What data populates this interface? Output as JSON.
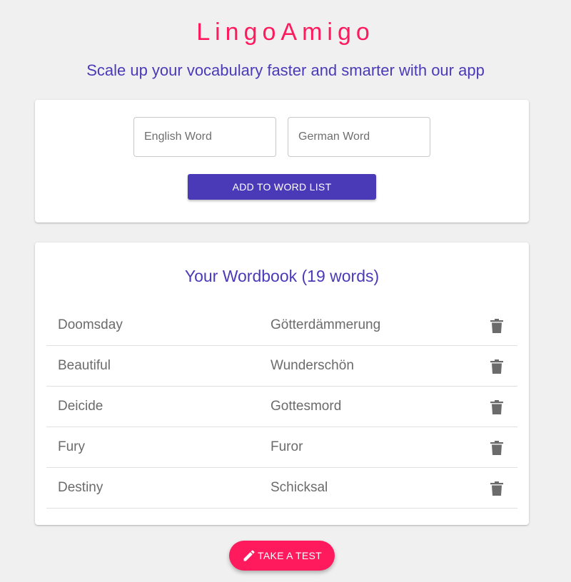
{
  "colors": {
    "brand": "#ff1a5e",
    "accent": "#4a3ab8",
    "fab": "#ff1a5e"
  },
  "header": {
    "title": "LingoAmigo",
    "subtitle": "Scale up your vocabulary faster and smarter with our app"
  },
  "add_form": {
    "english_placeholder": "English Word",
    "german_placeholder": "German Word",
    "english_value": "",
    "german_value": "",
    "add_button_label": "ADD TO WORD LIST"
  },
  "wordbook": {
    "title": "Your Wordbook (19 words)",
    "rows": [
      {
        "english": "Doomsday",
        "german": "Götterdämmerung",
        "icon": "trash-icon"
      },
      {
        "english": "Beautiful",
        "german": "Wunderschön",
        "icon": "trash-icon"
      },
      {
        "english": "Deicide",
        "german": "Gottesmord",
        "icon": "trash-icon"
      },
      {
        "english": "Fury",
        "german": "Furor",
        "icon": "trash-icon"
      },
      {
        "english": "Destiny",
        "german": "Schicksal",
        "icon": "trash-icon"
      }
    ]
  },
  "test_button": {
    "label": "TAKE A TEST",
    "icon": "pencil-icon"
  }
}
